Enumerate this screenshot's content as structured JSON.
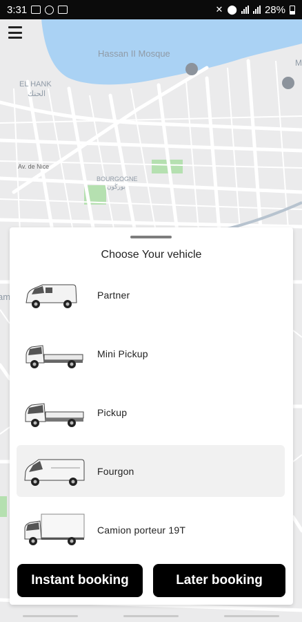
{
  "status_bar": {
    "time": "3:31",
    "battery": "28%"
  },
  "map": {
    "labels": {
      "hassan": "Hassan II Mosque",
      "el_hank": "EL HANK",
      "el_hank_ar": "الحنك",
      "av_de_nice": "Av. de Nice",
      "bourgogne": "BOURGOGNE",
      "bourgogne_ar": "بورڭون",
      "edge_left": "am",
      "edge_right": "M"
    },
    "colors": {
      "water": "#aad2f4",
      "park": "#b5e0b0",
      "road": "#ffffff",
      "land": "#ebebec"
    }
  },
  "sheet": {
    "title": "Choose Your vehicle",
    "vehicles": [
      {
        "label": "Partner",
        "icon": "van-icon"
      },
      {
        "label": "Mini Pickup",
        "icon": "mini-pickup-icon"
      },
      {
        "label": "Pickup",
        "icon": "pickup-icon"
      },
      {
        "label": "Fourgon",
        "icon": "fourgon-icon",
        "selected": true
      },
      {
        "label": "Camion porteur 19T",
        "icon": "truck-icon"
      }
    ],
    "actions": {
      "instant": "Instant booking",
      "later": "Later booking"
    }
  }
}
